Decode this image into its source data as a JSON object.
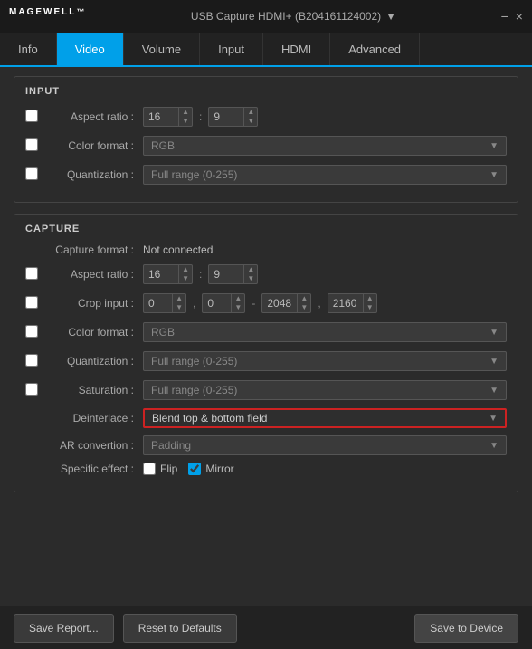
{
  "app": {
    "logo": "MAGEWELL",
    "logo_tm": "™",
    "device_name": "USB Capture HDMI+ (B204161124002)",
    "dropdown_arrow": "▼",
    "close": "×",
    "minimize": "−",
    "titlebar_arrow": "▼"
  },
  "tabs": [
    {
      "id": "info",
      "label": "Info"
    },
    {
      "id": "video",
      "label": "Video",
      "active": true
    },
    {
      "id": "volume",
      "label": "Volume"
    },
    {
      "id": "input",
      "label": "Input"
    },
    {
      "id": "hdmi",
      "label": "HDMI"
    },
    {
      "id": "advanced",
      "label": "Advanced"
    }
  ],
  "input_section": {
    "title": "INPUT",
    "rows": [
      {
        "label": "Aspect ratio :",
        "type": "spinbox_pair",
        "val1": "16",
        "val2": "9",
        "checked": false
      },
      {
        "label": "Color format :",
        "type": "dropdown",
        "value": "RGB",
        "checked": false
      },
      {
        "label": "Quantization :",
        "type": "dropdown",
        "value": "Full range (0-255)",
        "checked": false
      }
    ]
  },
  "capture_section": {
    "title": "CAPTURE",
    "capture_format_label": "Capture format :",
    "capture_format_value": "Not connected",
    "rows": [
      {
        "label": "Aspect ratio :",
        "type": "spinbox_pair",
        "val1": "16",
        "val2": "9",
        "checked": false
      },
      {
        "label": "Crop input :",
        "type": "spinbox_quad",
        "val1": "0",
        "val2": "0",
        "val3": "2048",
        "val4": "2160",
        "checked": false
      },
      {
        "label": "Color format :",
        "type": "dropdown",
        "value": "RGB",
        "checked": false
      },
      {
        "label": "Quantization :",
        "type": "dropdown",
        "value": "Full range (0-255)",
        "checked": false
      },
      {
        "label": "Saturation :",
        "type": "dropdown",
        "value": "Full range (0-255)",
        "checked": false
      }
    ],
    "deinterlace_label": "Deinterlace :",
    "deinterlace_value": "Blend top & bottom field",
    "ar_conversion_label": "AR convertion :",
    "ar_conversion_value": "Padding",
    "specific_effect_label": "Specific effect :",
    "flip_label": "Flip",
    "mirror_label": "Mirror",
    "flip_checked": false,
    "mirror_checked": true
  },
  "footer": {
    "save_report": "Save Report...",
    "reset_defaults": "Reset to Defaults",
    "save_device": "Save to Device"
  }
}
